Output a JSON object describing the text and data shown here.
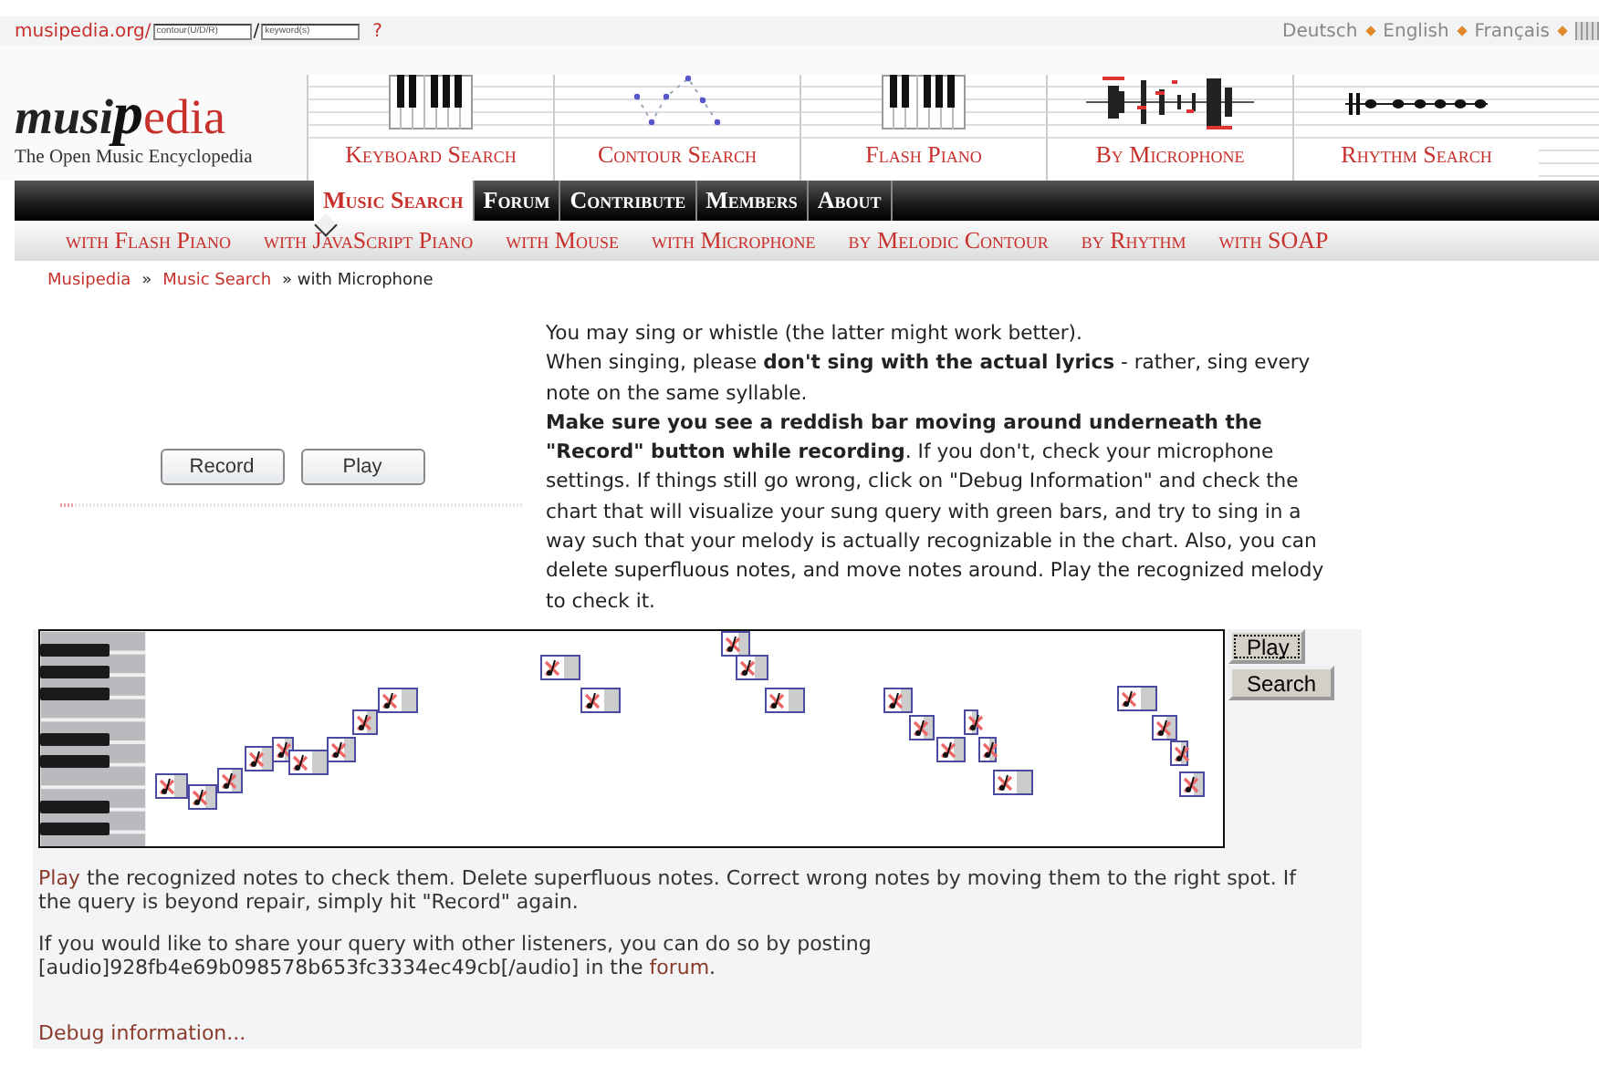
{
  "url_bar": {
    "prefix": "musipedia.org/",
    "contour_placeholder": "contour(U/D/R)",
    "separator": "/",
    "keyword_placeholder": "keyword(s)",
    "help": "?"
  },
  "languages": [
    "Deutsch",
    "English",
    "Français"
  ],
  "logo": {
    "parts": [
      {
        "text": "musi",
        "kind": "dark"
      },
      {
        "text": "p",
        "kind": "big"
      },
      {
        "text": "edia",
        "kind": "accent"
      }
    ],
    "tagline": "The Open Music Encyclopedia"
  },
  "search_modes": [
    {
      "label": "Keyboard Search",
      "kind": "keyboard"
    },
    {
      "label": "Contour Search",
      "kind": "contour"
    },
    {
      "label": "Flash Piano",
      "kind": "keyboard"
    },
    {
      "label": "By Microphone",
      "kind": "microphone"
    },
    {
      "label": "Rhythm Search",
      "kind": "rhythm"
    }
  ],
  "tabs": [
    {
      "label": "Music Search",
      "selected": true
    },
    {
      "label": "Forum",
      "selected": false
    },
    {
      "label": "Contribute",
      "selected": false
    },
    {
      "label": "Members",
      "selected": false
    },
    {
      "label": "About",
      "selected": false
    }
  ],
  "subnav": [
    "with Flash Piano",
    "with JavaScript Piano",
    "with Mouse",
    "with Microphone",
    "by Melodic Contour",
    "by Rhythm",
    "with SOAP"
  ],
  "breadcrumb": {
    "links": [
      "Musipedia",
      "Music Search"
    ],
    "separator": "»",
    "current": "» with Microphone"
  },
  "recorder": {
    "buttons": [
      "Record",
      "Play"
    ],
    "meter": {
      "level": 0.03
    }
  },
  "instructions": [
    "You may sing or whistle (the latter might work better).",
    "When singing, please **don't sing with the actual lyrics** - rather, sing every note on the same syllable.",
    "**Make sure you see a reddish bar moving around underneath the \"Record\" button while recording**. If you don't, check your microphone settings. If things still go wrong, click on \"Debug Information\" and check the chart that will visualize your sung query with green bars, and try to sing in a way such that your melody is actually recognizable in the chart. Also, you can delete superfluous notes, and move notes around. Play the recognized melody to check it."
  ],
  "editor_buttons": [
    {
      "label": "Play",
      "focused": true
    },
    {
      "label": "Search",
      "focused": false
    }
  ],
  "notes_help": {
    "link": "Play",
    "text": " the recognized notes to check them. Delete superfluous notes. Correct wrong notes by moving them to the right spot. If the query is beyond repair, simply hit \"Record\" again."
  },
  "share": {
    "text": "If you would like to share your query with other listeners, you can do so by posting [audio]928fb4e69b098578b653fc3334ec49cb[/audio] in the ",
    "link": "forum",
    "end": "."
  },
  "debug_link": "Debug information..."
}
